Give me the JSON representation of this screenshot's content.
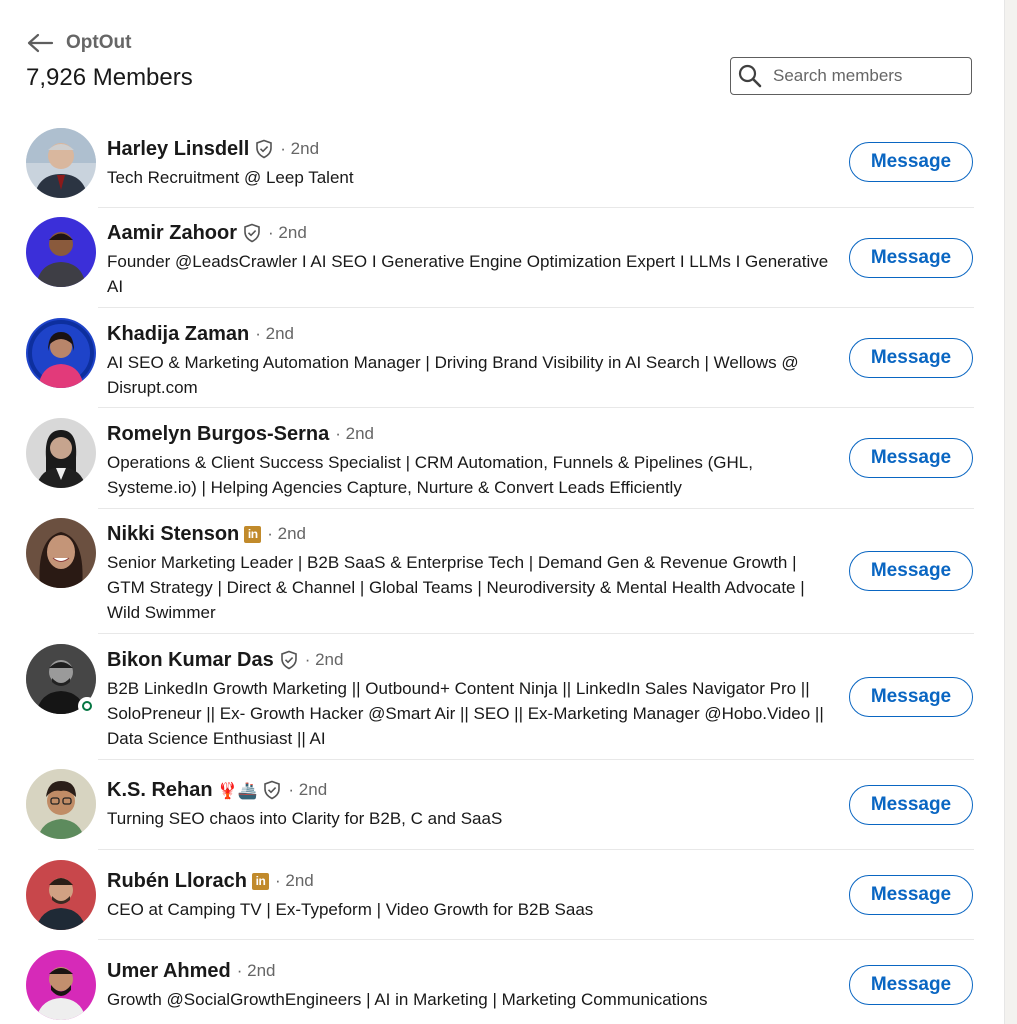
{
  "header": {
    "group_name": "OptOut",
    "member_count": "7,926 Members",
    "search_placeholder": "Search members"
  },
  "colors": {
    "accent": "#0a66c2",
    "muted_text": "#666666",
    "open_to_work": "#057642",
    "linkedin_premium_badge": "#c18a2b"
  },
  "members": [
    {
      "name": "Harley Linsdell",
      "badge": "verified-icon",
      "degree": "· 2nd",
      "headline": "Tech Recruitment @ Leep Talent",
      "action": "Message"
    },
    {
      "name": "Aamir Zahoor",
      "badge": "verified-icon",
      "degree": "· 2nd",
      "headline": "Founder @LeadsCrawler I AI SEO I Generative Engine Optimization Expert I LLMs I Generative AI",
      "action": "Message"
    },
    {
      "name": "Khadija Zaman",
      "badge": "",
      "degree": "· 2nd",
      "headline": "AI SEO & Marketing Automation Manager | Driving Brand Visibility in AI Search | Wellows @ Disrupt.com",
      "action": "Message"
    },
    {
      "name": "Romelyn Burgos-Serna",
      "badge": "",
      "degree": "· 2nd",
      "headline": "Operations & Client Success Specialist | CRM Automation, Funnels & Pipelines (GHL, Systeme.io) | Helping Agencies Capture, Nurture & Convert Leads Efficiently",
      "action": "Message"
    },
    {
      "name": "Nikki Stenson",
      "badge": "linkedin-premium-icon",
      "badge_text": "in",
      "degree": "· 2nd",
      "headline": "Senior Marketing Leader | B2B SaaS & Enterprise Tech | Demand Gen & Revenue Growth | GTM Strategy | Direct & Channel | Global Teams | Neurodiversity & Mental Health Advocate | Wild Swimmer",
      "action": "Message"
    },
    {
      "name": "Bikon Kumar Das",
      "badge": "verified-icon",
      "degree": "· 2nd",
      "headline": "B2B LinkedIn Growth Marketing || Outbound+ Content Ninja || LinkedIn Sales Navigator Pro || SoloPreneur || Ex- Growth Hacker @Smart Air || SEO || Ex-Marketing Manager @Hobo.Video || Data Science Enthusiast || AI",
      "action": "Message"
    },
    {
      "name": "K.S. Rehan",
      "name_emoji": "🦞🚢",
      "badge": "verified-icon",
      "degree": "· 2nd",
      "headline": "Turning SEO chaos into Clarity for B2B, C and SaaS",
      "action": "Message"
    },
    {
      "name": "Rubén Llorach",
      "badge": "linkedin-premium-icon",
      "badge_text": "in",
      "degree": "· 2nd",
      "headline": "CEO at Camping TV | Ex-Typeform | Video Growth for B2B Saas",
      "action": "Message"
    },
    {
      "name": "Umer Ahmed",
      "badge": "",
      "degree": "· 2nd",
      "headline": "Growth @SocialGrowthEngineers | AI in Marketing | Marketing Communications",
      "action": "Message"
    }
  ]
}
